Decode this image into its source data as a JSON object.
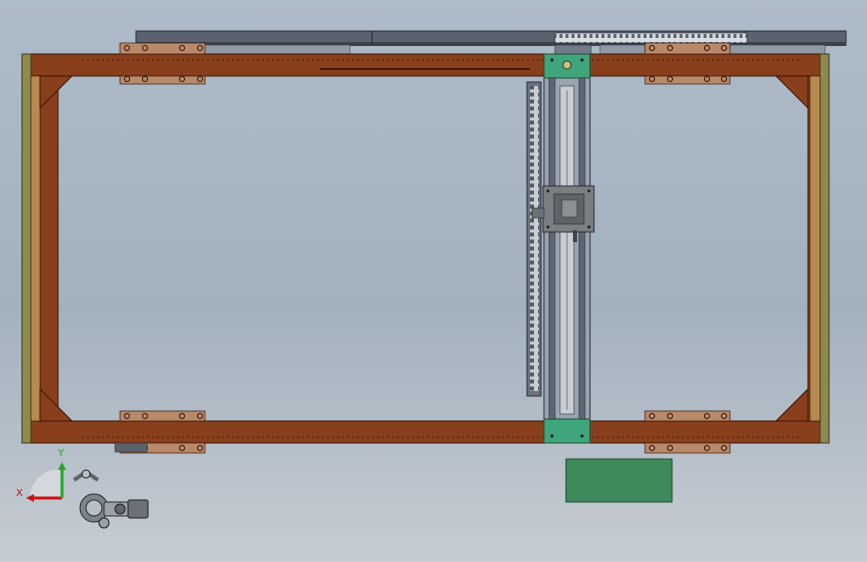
{
  "viewport": {
    "background_top": "#aebbc8",
    "background_bottom": "#c6ccd2"
  },
  "colors": {
    "frame_wood": "#8a3f1c",
    "frame_edge": "#4a1e0a",
    "end_plate": "#8f8a4e",
    "mount_plate": "#b98a6a",
    "rail_dark": "#505865",
    "gantry_rail": "#6f7b88",
    "gantry_accent": "#3fa57a",
    "carriage": "#7c7f82",
    "green_box": "#3f8a5c",
    "axis_x": "#cc1111",
    "axis_y": "#22aa22"
  },
  "triad": {
    "x_label": "X",
    "y_label": "Y",
    "icon": "coordinate-triad-icon"
  },
  "parts": {
    "frame": "rectangular-steel-frame",
    "gantry": "y-axis-gantry",
    "carriage": "xy-carriage",
    "cable_chain": "drag-chain",
    "box": "electrical-box"
  }
}
